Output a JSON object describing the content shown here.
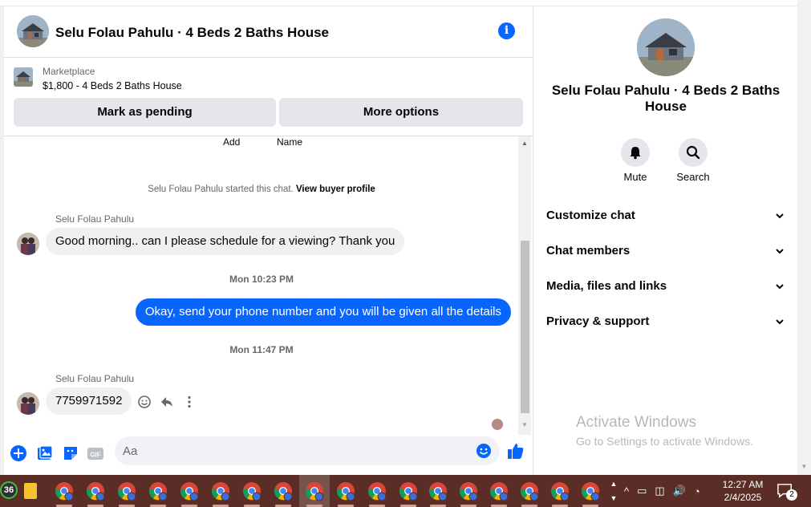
{
  "chat": {
    "title": "Selu Folau Pahulu · 4 Beds 2 Baths House",
    "info_icon": "info-icon"
  },
  "marketplace": {
    "label": "Marketplace",
    "listing": "$1,800 - 4 Beds 2 Baths House",
    "mark_pending": "Mark as pending",
    "more_options": "More options"
  },
  "messages": {
    "cutoff_left": "Add",
    "cutoff_right": "Name",
    "system_prefix": "Selu Folau Pahulu started this chat.",
    "system_link": "View buyer profile",
    "sender_1": "Selu Folau Pahulu",
    "msg_1": "Good morning.. can I please schedule for a viewing? Thank you",
    "time_1": "Mon 10:23 PM",
    "msg_2": "Okay, send your phone number and you will be given all the details",
    "time_2": "Mon 11:47 PM",
    "sender_2": "Selu Folau Pahulu",
    "msg_3": "7759971592"
  },
  "composer": {
    "placeholder": "Aa",
    "tools": [
      "plus-icon",
      "photo-icon",
      "sticker-icon",
      "gif-icon"
    ],
    "gif_label": "GIF"
  },
  "info_panel": {
    "title": "Selu Folau Pahulu · 4 Beds 2 Baths House",
    "mute_label": "Mute",
    "search_label": "Search",
    "sections": [
      "Customize chat",
      "Chat members",
      "Media, files and links",
      "Privacy & support"
    ]
  },
  "watermark": {
    "line1": "Activate Windows",
    "line2": "Go to Settings to activate Windows."
  },
  "taskbar": {
    "badge": "36",
    "time": "12:27 AM",
    "date": "2/4/2025",
    "notifications": "2"
  },
  "colors": {
    "accent": "#0866ff",
    "bubble_in": "#f0f0f0",
    "taskbar": "#5a2e27"
  }
}
